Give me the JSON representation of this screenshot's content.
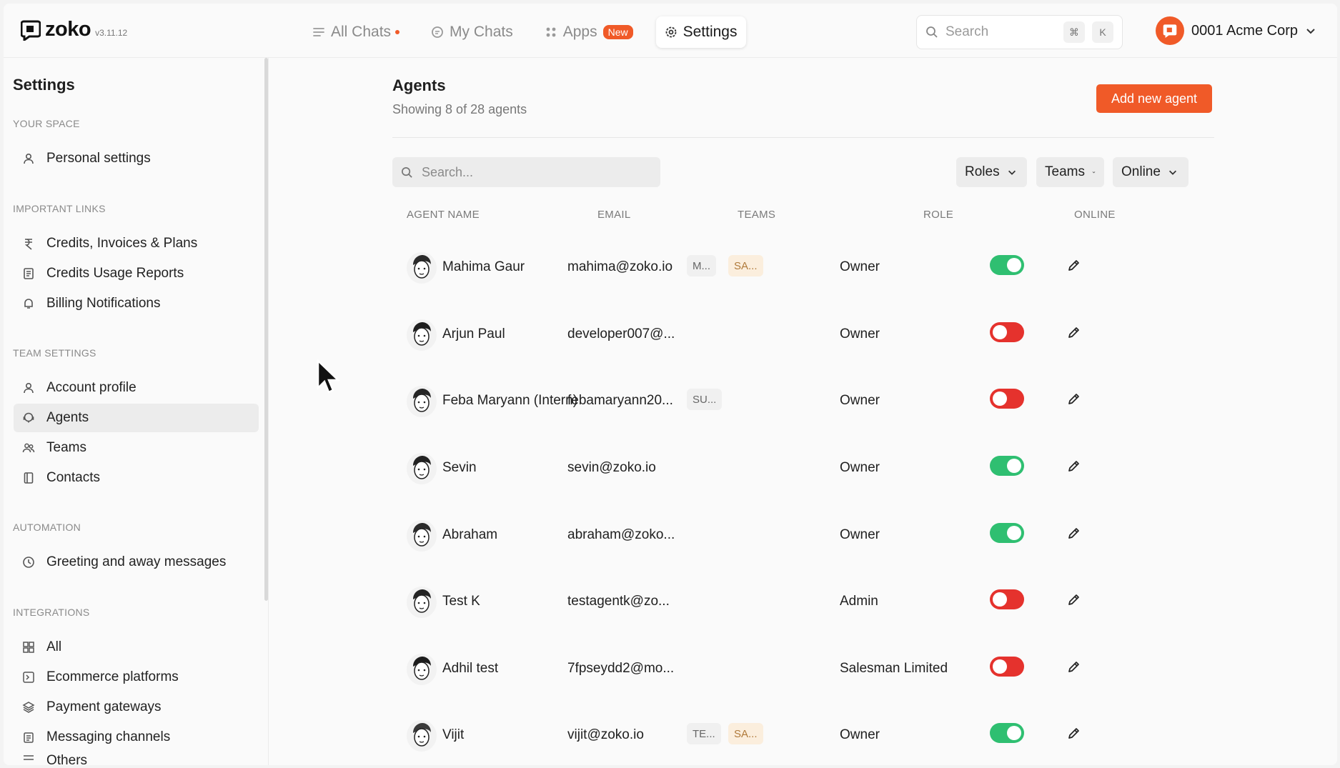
{
  "app": {
    "name": "zoko",
    "version": "v3.11.12"
  },
  "nav": [
    {
      "label": "All Chats",
      "icon": "list-icon",
      "dot": true
    },
    {
      "label": "My Chats",
      "icon": "chat-icon"
    },
    {
      "label": "Apps",
      "icon": "apps-grid-icon",
      "badge": "New"
    },
    {
      "label": "Settings",
      "icon": "gear-icon",
      "active": true
    }
  ],
  "search": {
    "placeholder": "Search",
    "keys": [
      "⌘",
      "K"
    ]
  },
  "account": {
    "name": "0001 Acme Corp"
  },
  "sidebar": {
    "title": "Settings",
    "sections": [
      {
        "label": "YOUR SPACE",
        "items": [
          {
            "label": "Personal settings",
            "icon": "user-icon"
          }
        ]
      },
      {
        "label": "IMPORTANT LINKS",
        "items": [
          {
            "label": "Credits, Invoices & Plans",
            "icon": "rupee-icon"
          },
          {
            "label": "Credits Usage Reports",
            "icon": "report-icon"
          },
          {
            "label": "Billing Notifications",
            "icon": "bell-icon"
          }
        ]
      },
      {
        "label": "TEAM SETTINGS",
        "items": [
          {
            "label": "Account profile",
            "icon": "user-icon"
          },
          {
            "label": "Agents",
            "icon": "agent-icon",
            "active": true
          },
          {
            "label": "Teams",
            "icon": "users-icon"
          },
          {
            "label": "Contacts",
            "icon": "book-icon"
          }
        ]
      },
      {
        "label": "AUTOMATION",
        "items": [
          {
            "label": "Greeting and away messages",
            "icon": "clock-icon"
          }
        ]
      },
      {
        "label": "INTEGRATIONS",
        "items": [
          {
            "label": "All",
            "icon": "grid-icon"
          },
          {
            "label": "Ecommerce platforms",
            "icon": "terminal-icon"
          },
          {
            "label": "Payment gateways",
            "icon": "layers-icon"
          },
          {
            "label": "Messaging channels",
            "icon": "clipboard-icon"
          },
          {
            "label": "Others",
            "icon": "list-icon"
          }
        ]
      }
    ]
  },
  "page": {
    "title": "Agents",
    "subtitle": "Showing 8 of 28 agents",
    "add_button": "Add new agent",
    "search_placeholder": "Search...",
    "filters": [
      "Roles",
      "Teams",
      "Online"
    ],
    "columns": [
      "AGENT NAME",
      "EMAIL",
      "TEAMS",
      "ROLE",
      "ONLINE"
    ]
  },
  "agents": [
    {
      "name": "Mahima Gaur",
      "email": "mahima@zoko.io",
      "teams": [
        "M...",
        "SA..."
      ],
      "role": "Owner",
      "online": true
    },
    {
      "name": "Arjun Paul",
      "email": "developer007@...",
      "teams": [],
      "role": "Owner",
      "online": false
    },
    {
      "name": "Feba Maryann (Intern)",
      "email": "febamaryann20...",
      "teams": [
        "SU..."
      ],
      "role": "Owner",
      "online": false
    },
    {
      "name": "Sevin",
      "email": "sevin@zoko.io",
      "teams": [],
      "role": "Owner",
      "online": true
    },
    {
      "name": "Abraham",
      "email": "abraham@zoko...",
      "teams": [],
      "role": "Owner",
      "online": true
    },
    {
      "name": "Test K",
      "email": "testagentk@zo...",
      "teams": [],
      "role": "Admin",
      "online": false
    },
    {
      "name": "Adhil test",
      "email": "7fpseydd2@mo...",
      "teams": [],
      "role": "Salesman Limited",
      "online": false
    },
    {
      "name": "Vijit",
      "email": "vijit@zoko.io",
      "teams": [
        "TE...",
        "SA..."
      ],
      "role": "Owner",
      "online": true
    }
  ],
  "colors": {
    "accent": "#f05a28",
    "toggle_on": "#2fbf71",
    "toggle_off": "#e5322d"
  }
}
